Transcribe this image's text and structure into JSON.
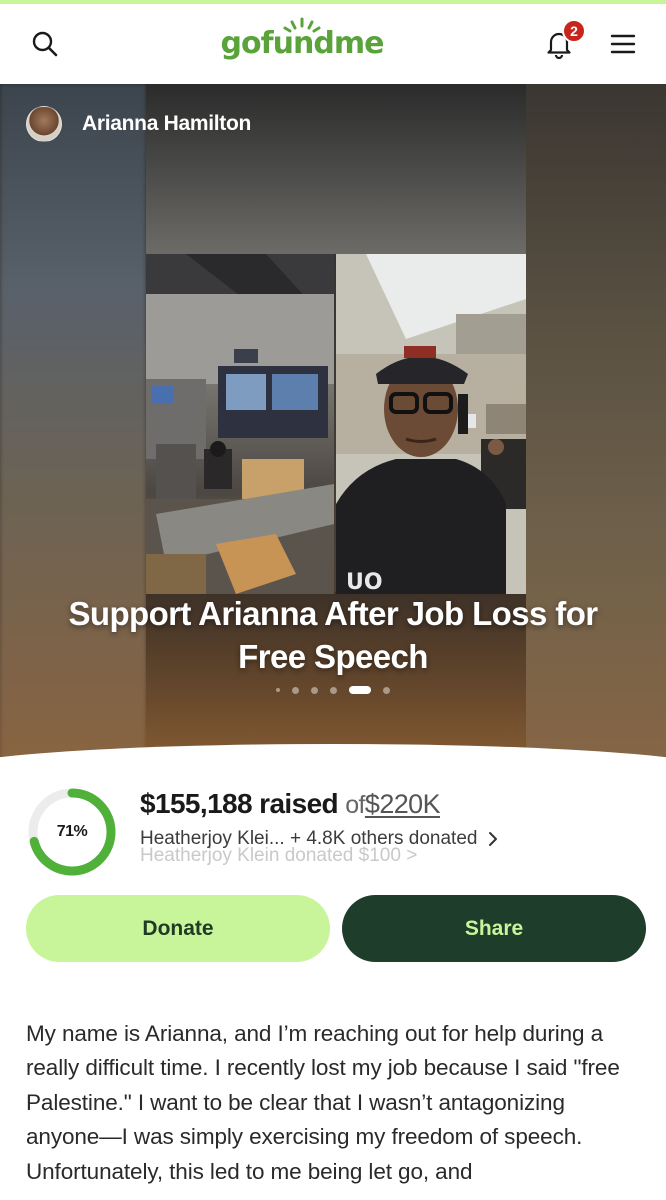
{
  "app": {
    "logo_text": "gofundme",
    "notifications_count": "2"
  },
  "campaign": {
    "owner_name": "Arianna Hamilton",
    "title": "Support Arianna After Job Loss for Free Speech",
    "carousel": {
      "total_slides": 6,
      "active_index": 4
    },
    "progress_percent_label": "71%",
    "progress_fraction": 0.71,
    "raised_amount": "$155,188 raised",
    "raised_of": "of",
    "goal": "$220K",
    "donors_summary": "Heatherjoy Klei... + 4.8K others donated",
    "donors_ticker": "Heatherjoy Klein donated $100 >",
    "donate_label": "Donate",
    "share_label": "Share",
    "story_text": "My name is Arianna, and I’m reaching out for help during a really difficult time. I recently lost my job because I said \"free Palestine.\" I want to be clear that I wasn’t antagonizing anyone—I was simply exercising my freedom of speech. Unfortunately, this led to me being let go, and"
  },
  "colors": {
    "brand_green": "#5aa33b",
    "accent_light_green": "#c8f59a",
    "dark_green": "#1f3d2b",
    "badge_red": "#c8261c"
  },
  "icons": {
    "search": "search-icon",
    "bell": "bell-icon",
    "menu": "menu-icon",
    "chevron": "chevron-right-icon"
  }
}
